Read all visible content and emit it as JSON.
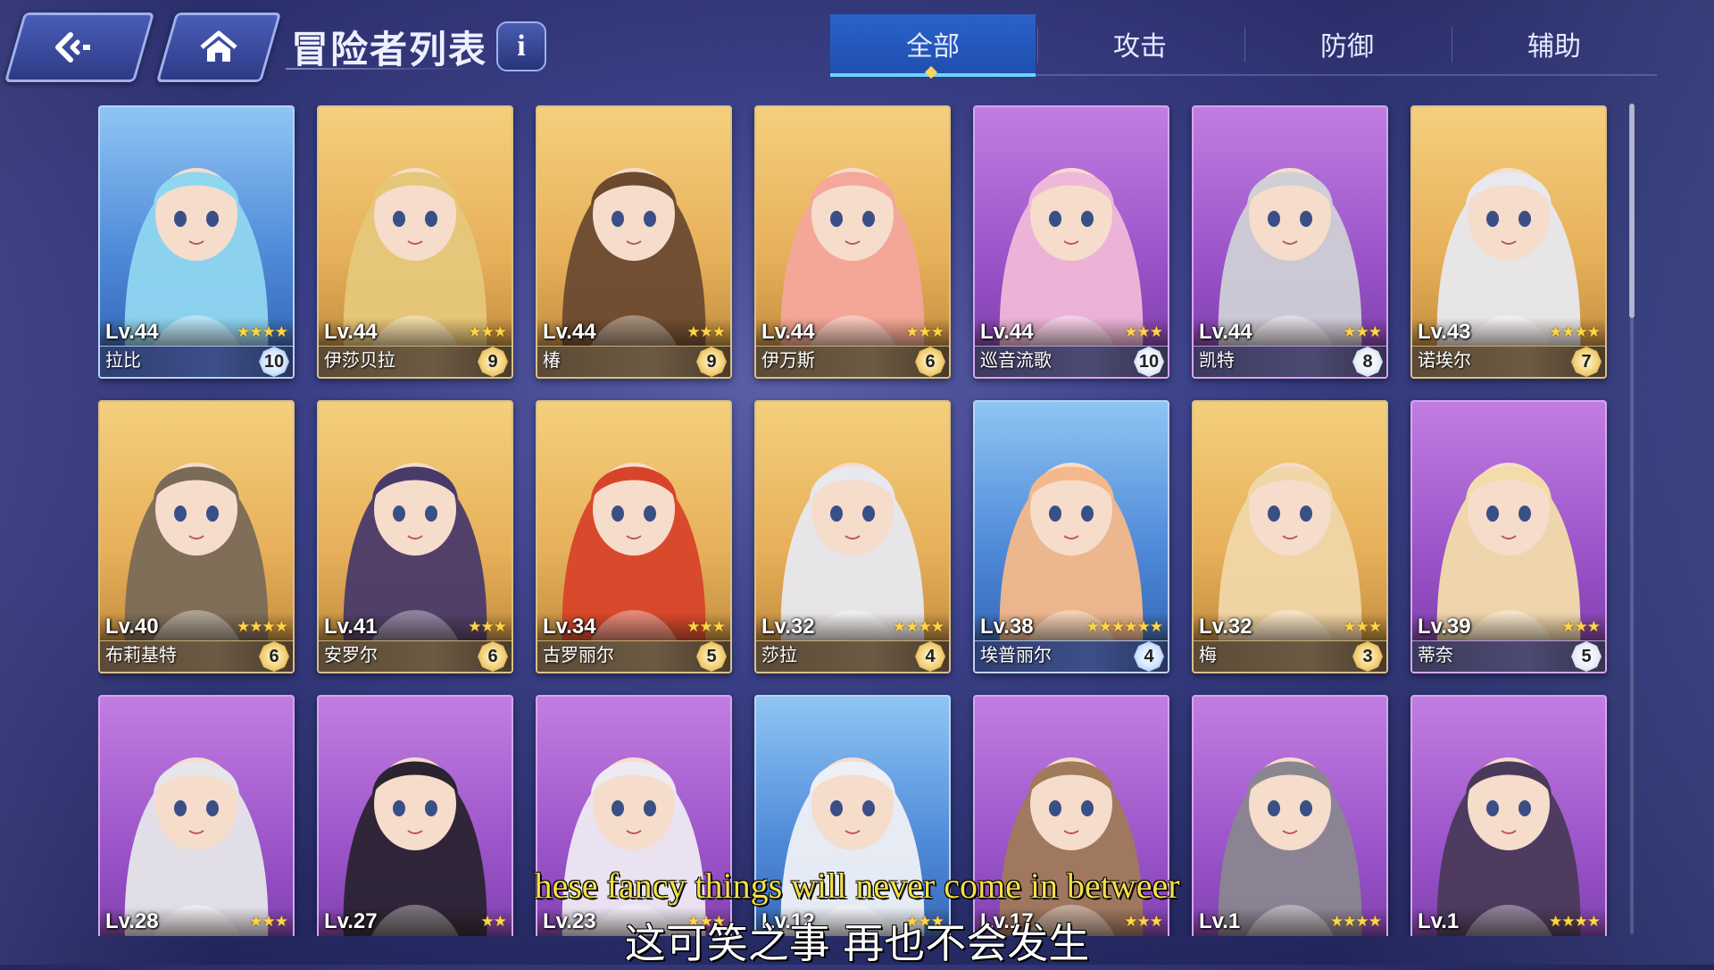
{
  "header": {
    "title": "冒险者列表",
    "info_label": "i"
  },
  "tabs": [
    {
      "label": "全部",
      "active": true
    },
    {
      "label": "攻击",
      "active": false
    },
    {
      "label": "防御",
      "active": false
    },
    {
      "label": "辅助",
      "active": false
    }
  ],
  "adventurers": [
    {
      "level": "Lv.44",
      "name": "拉比",
      "stars": 4,
      "badge": "10",
      "frame": "blue",
      "hair": "#8fd6f0"
    },
    {
      "level": "Lv.44",
      "name": "伊莎贝拉",
      "stars": 3,
      "badge": "9",
      "frame": "gold",
      "hair": "#e6c77a"
    },
    {
      "level": "Lv.44",
      "name": "椿",
      "stars": 3,
      "badge": "9",
      "frame": "gold",
      "hair": "#6b4a30"
    },
    {
      "level": "Lv.44",
      "name": "伊万斯",
      "stars": 3,
      "badge": "6",
      "frame": "gold",
      "hair": "#f4a79a"
    },
    {
      "level": "Lv.44",
      "name": "巡音流歌",
      "stars": 3,
      "badge": "10",
      "frame": "purple",
      "hair": "#f0b8d8"
    },
    {
      "level": "Lv.44",
      "name": "凯特",
      "stars": 3,
      "badge": "8",
      "frame": "purple",
      "hair": "#cfcfd6"
    },
    {
      "level": "Lv.43",
      "name": "诺埃尔",
      "stars": 4,
      "badge": "7",
      "frame": "gold",
      "hair": "#e8e8ee"
    },
    {
      "level": "Lv.40",
      "name": "布莉基特",
      "stars": 4,
      "badge": "6",
      "frame": "gold",
      "hair": "#7a6a58"
    },
    {
      "level": "Lv.41",
      "name": "安罗尔",
      "stars": 3,
      "badge": "6",
      "frame": "gold",
      "hair": "#4a3a6a"
    },
    {
      "level": "Lv.34",
      "name": "古罗丽尔",
      "stars": 3,
      "badge": "5",
      "frame": "gold",
      "hair": "#d8442a"
    },
    {
      "level": "Lv.32",
      "name": "莎拉",
      "stars": 4,
      "badge": "4",
      "frame": "gold",
      "hair": "#e8e8f0"
    },
    {
      "level": "Lv.38",
      "name": "埃普丽尔",
      "stars": 6,
      "badge": "4",
      "frame": "blue",
      "hair": "#f4b88a"
    },
    {
      "level": "Lv.32",
      "name": "梅",
      "stars": 3,
      "badge": "3",
      "frame": "gold",
      "hair": "#f0d6a8"
    },
    {
      "level": "Lv.39",
      "name": "蒂奈",
      "stars": 3,
      "badge": "5",
      "frame": "purple",
      "hair": "#f3dcaa"
    },
    {
      "level": "Lv.28",
      "name": "",
      "stars": 3,
      "badge": "",
      "frame": "purple",
      "hair": "#e6e6ea"
    },
    {
      "level": "Lv.27",
      "name": "",
      "stars": 2,
      "badge": "",
      "frame": "purple",
      "hair": "#2a2330"
    },
    {
      "level": "Lv.23",
      "name": "",
      "stars": 3,
      "badge": "",
      "frame": "purple",
      "hair": "#eeeaf2"
    },
    {
      "level": "Lv.12",
      "name": "",
      "stars": 3,
      "badge": "",
      "frame": "blue",
      "hair": "#eef0f6"
    },
    {
      "level": "Lv.17",
      "name": "",
      "stars": 3,
      "badge": "",
      "frame": "purple",
      "hair": "#a07a5a"
    },
    {
      "level": "Lv.1",
      "name": "",
      "stars": 4,
      "badge": "",
      "frame": "purple",
      "hair": "#8a8690"
    },
    {
      "level": "Lv.1",
      "name": "",
      "stars": 4,
      "badge": "",
      "frame": "purple",
      "hair": "#4a3a5a"
    }
  ],
  "subtitles": {
    "english": "hese fancy things will never come in betweer",
    "chinese": "这可笑之事 再也不会发生"
  }
}
